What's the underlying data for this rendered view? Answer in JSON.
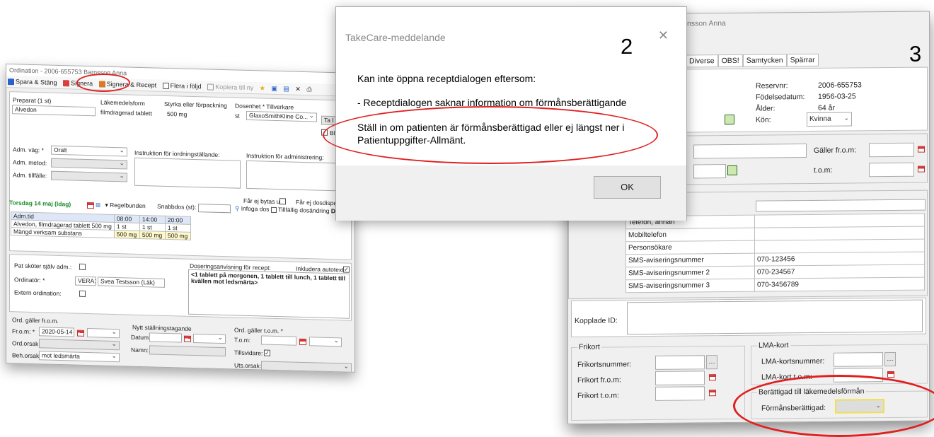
{
  "left_window": {
    "title": "Ordination - 2006-655753 Barnsson Anna",
    "toolbar": {
      "save_close": "Spara & Stäng",
      "sign": "Signera",
      "sign_prescription": "Signera & Recept",
      "multiple": "Flera i följd",
      "copy": "Kopiera till ny"
    },
    "product": {
      "h_preparat": "Preparat (1 st)",
      "h_form": "Läkemedelsform",
      "h_strength": "Styrka eller förpackning",
      "h_unit": "Dosenhet * Tillverkare",
      "preparat": "Alvedon",
      "form": "filmdragerad tablett",
      "strength": "500 mg",
      "unit": "st",
      "maker": "GlaxoSmithKline Co...",
      "btn_ta": "Ta l",
      "cb_blan": "Blan"
    },
    "admin": {
      "route_label": "Adm. väg: *",
      "route_value": "Oralt",
      "method_label": "Adm. metod:",
      "occasion_label": "Adm. tillfälle:",
      "instr_order_label": "Instruktion för iordningställande:",
      "instr_admin_label": "Instruktion för administrering:",
      "no_swap_label": "Får ej bytas ut:",
      "no_dosedisp_label": "Får ej dosdispenser"
    },
    "dosing": {
      "date": "Torsdag 14 maj (Idag)",
      "regular": "Regelbunden",
      "snabbdos_label": "Snabbdos (st):",
      "infoga": "Infoga dos",
      "temp": "Tillfällig dosändring",
      "dosing_word": "Dosering",
      "table": {
        "col0": "Adm.tid",
        "times": [
          "08:00",
          "14:00",
          "20:00"
        ],
        "row1": "Alvedon, filmdragerad tablett 500 mg",
        "row1_vals": [
          "1 st",
          "1 st",
          "1 st"
        ],
        "row2": "Mängd verksam substans",
        "row2_vals": [
          "500 mg",
          "500 mg",
          "500 mg"
        ]
      }
    },
    "prescriber": {
      "self_admin_label": "Pat sköter själv adm.:",
      "ordinator_label": "Ordinatör: *",
      "ordinator_code": "VERA1",
      "ordinator_name": "Svea Testsson (Läk)",
      "external_label": "Extern ordination:",
      "recipe_label": "Doseringsanvisning för recept:",
      "autotext_label": "Inkludera autotext:",
      "recipe_text": "<1 tablett på morgonen, 1 tablett till lunch, 1 tablett till kvällen mot ledsmärta>"
    },
    "validity": {
      "from_group": "Ord. gäller fr.o.m.",
      "from_label": "Fr.o.m: *",
      "from_value": "2020-05-14",
      "reason_label": "Ord.orsak:",
      "treat_label": "Beh.orsak:",
      "treat_value": "mot ledsmärta",
      "new_group": "Nytt ställningstagande",
      "datum_label": "Datum:",
      "namn_label": "Namn:",
      "tom_group": "Ord. gäller t.o.m. *",
      "tom_label": "T.o.m:",
      "until_label": "Tillsvidare:",
      "uts_label": "Uts.orsak:"
    }
  },
  "dialog": {
    "title": "TakeCare-meddelande",
    "number": "2",
    "line1": "Kan inte öppna receptdialogen eftersom:",
    "line2": " - Receptdialogen saknar information om förmånsberättigande",
    "line3": "Ställ in om patienten är förmånsberättigad eller ej längst ner i",
    "line4": "Patientuppgifter-Allmänt.",
    "ok": "OK"
  },
  "right_window": {
    "title_partial": "nsson Anna",
    "number": "3",
    "tabs": [
      "Diverse",
      "OBS!",
      "Samtycken",
      "Spärrar"
    ],
    "info": {
      "reservnr_label": "Reservnr:",
      "reservnr": "2006-655753",
      "dob_label": "Födelsedatum:",
      "dob": "1956-03-25",
      "age_label": "Ålder:",
      "age": "64 år",
      "sex_label": "Kön:",
      "sex": "Kvinna"
    },
    "valid_from_label": "Gäller fr.o.m:",
    "valid_to_label": "t.o.m:",
    "contacts": [
      {
        "label": "Telefon, annan",
        "value": ""
      },
      {
        "label": "Mobiltelefon",
        "value": ""
      },
      {
        "label": "Personsökare",
        "value": ""
      },
      {
        "label": "SMS-aviseringsnummer",
        "value": "070-123456"
      },
      {
        "label": "SMS-aviseringsnummer 2",
        "value": "070-234567"
      },
      {
        "label": "SMS-aviseringsnummer 3",
        "value": "070-3456789"
      }
    ],
    "linked_label": "Kopplade ID:",
    "frikort": {
      "group": "Frikort",
      "nr_label": "Frikortsnummer:",
      "from_label": "Frikort fr.o.m:",
      "to_label": "Frikort t.o.m:"
    },
    "lma": {
      "group": "LMA-kort",
      "nr_label": "LMA-kortsnummer:",
      "to_label": "LMA-kort t.o.m:"
    },
    "benefit": {
      "group": "Berättigad till läkemedelsförmån",
      "label": "Förmånsberättigad:"
    }
  }
}
